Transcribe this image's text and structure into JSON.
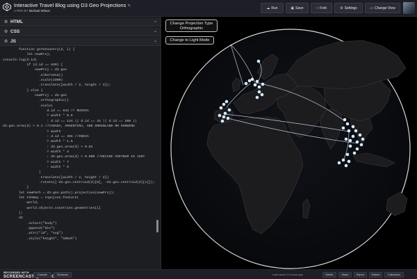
{
  "header": {
    "title": "Interactive Travel Blog using D3 Geo Projections",
    "byline_prefix": "A PEN BY",
    "author": "Michael Wilson",
    "buttons": [
      {
        "icon": "cloud-icon",
        "glyph": "☁",
        "label": "Run"
      },
      {
        "icon": "save-icon",
        "glyph": "▣",
        "label": "Save"
      },
      {
        "icon": "fork-icon",
        "glyph": "⑂",
        "label": "Fork"
      },
      {
        "icon": "gear-icon",
        "glyph": "⚙",
        "label": "Settings"
      },
      {
        "icon": "layout-icon",
        "glyph": "▭",
        "label": "Change View"
      }
    ]
  },
  "editor": {
    "panels": [
      {
        "label": "HTML"
      },
      {
        "label": "CSS"
      },
      {
        "label": "JS"
      }
    ],
    "code": [
      "        function goToCountry(d, i) {",
      "            let newProj;",
      "console.log(d.id)",
      "            if (d.id == 840) {",
      "                newProj = d3.geo",
      "                  .albersUsa()",
      "                  .scale(1000)",
      "                  .translate([width / 2, height / 2]);",
      "            } else {",
      "                newProj = d3.geo",
      "                  .orthographic()",
      "                  .scale(",
      "                      d.id == 643 // RUSSIA",
      "                      ? width * 0.6",
      "                      : d.id == 124 || d.id == 32 || d.id == 208 ||",
      "d3.geo.area(d) > 0.1 //CANADA, ARGENTINA, AND GREENLAND OR SHOWING",
      "                      ? width",
      "                      : d.id == 356 //INDIA",
      "                      ? width * 1.5",
      "                      : d3.geo.area(d) > 0.01",
      "                      ? width * 4",
      "                      : d3.geo.area(d) > 0.000 //DECIDE VIETNAM IS JUST",
      "                      ? width * 7",
      "                      : width * 9",
      "                  )",
      "                  .translate([width / 2, height / 2])",
      "                  .rotate([-d3.geo.centroid(d)[0], -d3.geo.centroid(d)[1]]);",
      "            }",
      "",
      "        let newPath = d3.geo.path().projection(newProj);",
      "",
      "        let tdsWay = topojson.feature(",
      "            world,",
      "            world.objects.countries.geometries[i]",
      "        );",
      "        d3",
      "            .select(\"body\")",
      "            .append(\"div\")",
      "            .attr(\"id\", \"svg\")",
      "            .style(\"height\", \"100vh\")"
    ]
  },
  "preview": {
    "projection_button": {
      "line1": "Change Projection Type",
      "line2": "Orthographic"
    },
    "theme_button": {
      "label": "Change to Light Mode"
    }
  },
  "footer": {
    "watermark_top": "RECORDED WITH",
    "watermark_bottom": "SCREENCAST ◉ MATIC",
    "left_buttons": [
      "Console",
      "Shortcuts"
    ],
    "last_saved": "Last saved 13 hours ago",
    "right_buttons": [
      "Delete",
      "Share",
      "Export",
      "Embed",
      "Collections"
    ]
  },
  "colors": {
    "background": "#000000",
    "editor_bg": "#1d1e22",
    "header_bg": "#1e1f26",
    "route_line": "#dbe9ff",
    "marker": "#d6ebff"
  }
}
